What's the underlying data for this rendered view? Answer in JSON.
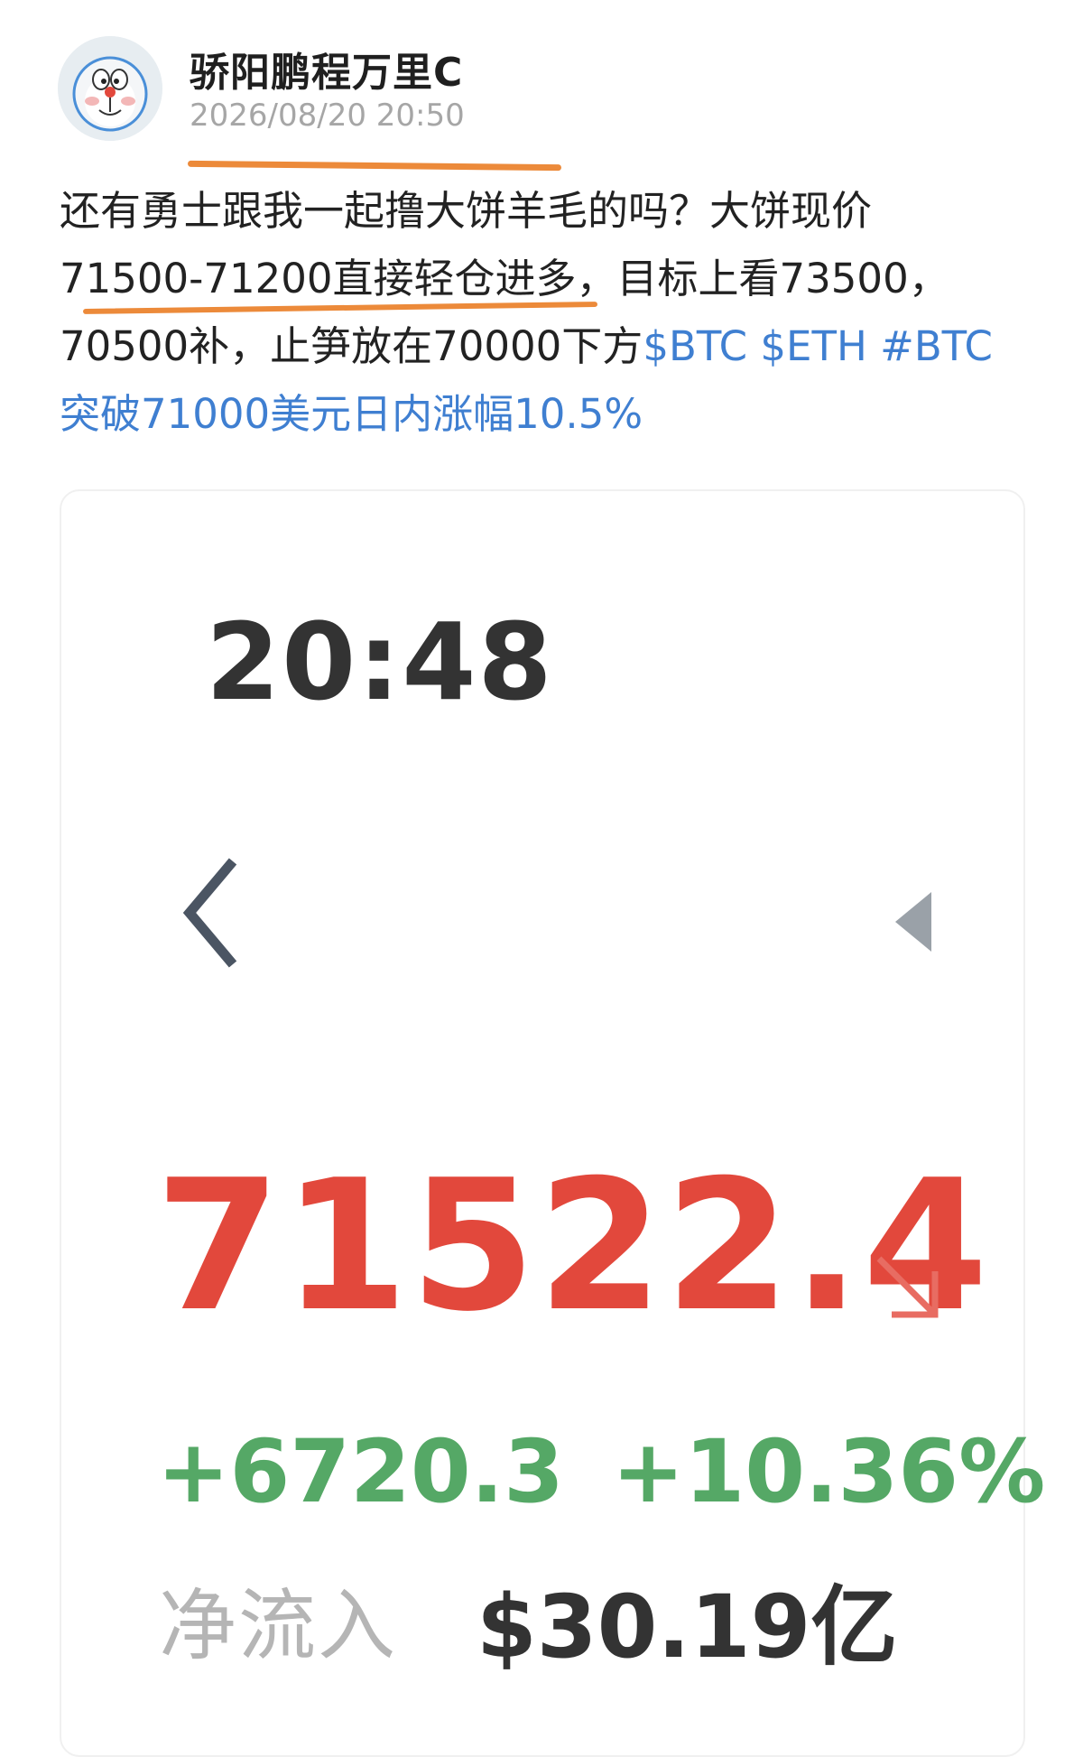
{
  "post": {
    "author": {
      "name": "骄阳鹏程万里C",
      "avatar_icon": "doraemon-avatar-icon"
    },
    "timestamp": "2026/08/20 20:50",
    "text": {
      "line1": "还有勇士跟我一起撸大饼羊毛的吗？大饼现价",
      "line2": "71500-71200直接轻仓进多，目标上看73500，",
      "line3_text": "70500补，止笋放在70000下方",
      "tag_btc": "$BTC",
      "tag_eth": "$ETH",
      "topic_part1": "#BTC",
      "topic_part2": "突破71000美元日内涨幅10.5%"
    },
    "colors": {
      "link": "#3f7fd1",
      "highlight_underline": "#ec8a3a"
    }
  },
  "screenshot": {
    "time": "20:48",
    "back_icon": "chevron-left-icon",
    "play_icon": "triangle-left-icon",
    "price": "71522.4",
    "trend_icon": "arrow-down-right-icon",
    "change_abs": "+6720.3",
    "change_pct": "+10.36%",
    "net_inflow_label": "净流入",
    "net_inflow_value": "$30.19亿",
    "colors": {
      "price": "#e2483c",
      "change": "#55a866"
    }
  }
}
